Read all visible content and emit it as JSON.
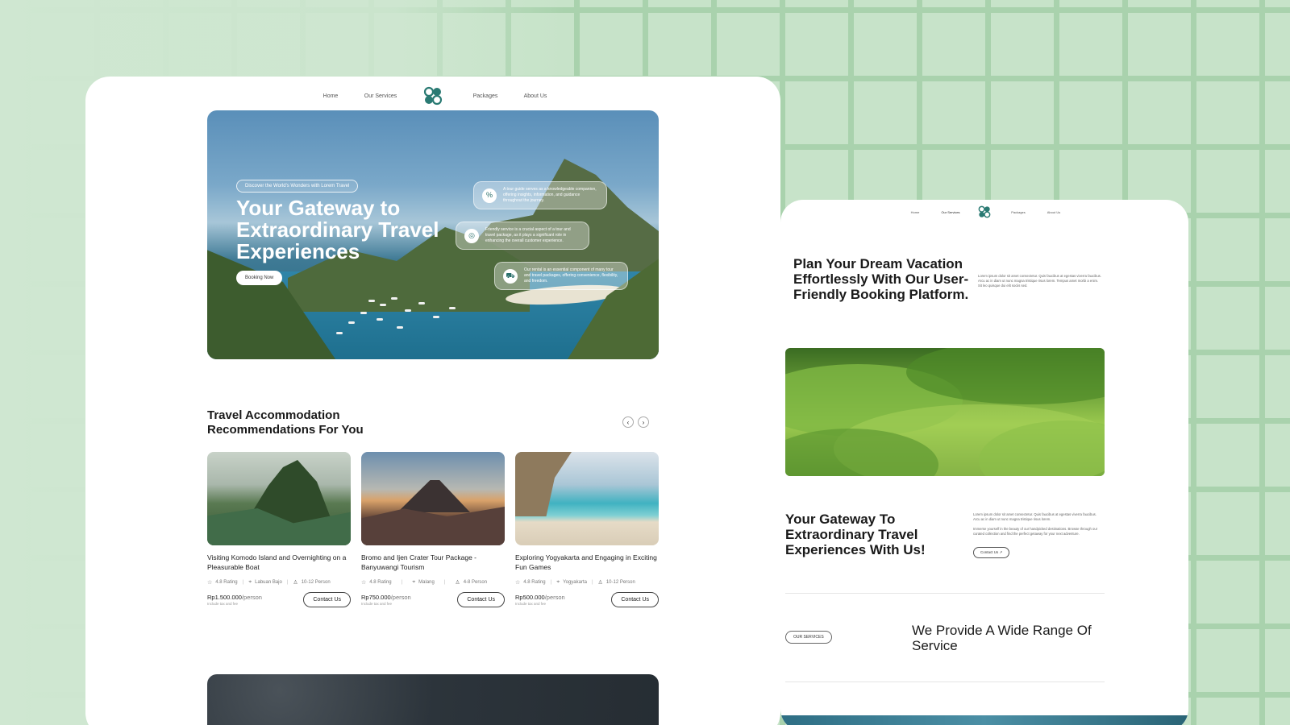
{
  "main": {
    "nav": {
      "home": "Home",
      "services": "Our Services",
      "packages": "Packages",
      "about": "About Us"
    },
    "hero": {
      "pill": "Discover the World's Wonders with Lorem Travel",
      "title": "Your Gateway to Extraordinary Travel Experiences",
      "cta": "Booking Now",
      "features": [
        {
          "icon": "percent-icon",
          "text": "A tour guide serves as a knowledgeable companion, offering insights, information, and guidance throughout the journey."
        },
        {
          "icon": "target-icon",
          "text": "Friendly service is a crucial aspect of a tour and travel package, as it plays a significant role in enhancing the overall customer experience."
        },
        {
          "icon": "car-icon",
          "text": "Our rental is an essential component of many tour and travel packages, offering convenience, flexibility, and freedom."
        }
      ]
    },
    "section_title": "Travel Accommodation Recommendations For You",
    "prev": "‹",
    "next": "›",
    "cards": [
      {
        "title": "Visiting Komodo Island and Overnighting on a Pleasurable Boat",
        "rating": "4.8 Rating",
        "location": "Labuan Bajo",
        "people": "10-12 Person",
        "price": "Rp1.500.000",
        "unit": "/person",
        "note": "Include tax and fee",
        "cta": "Contact Us"
      },
      {
        "title": "Bromo and Ijen Crater Tour Package - Banyuwangi Tourism",
        "rating": "4.8 Rating",
        "location": "Malang",
        "people": "4-8 Person",
        "price": "Rp750.000",
        "unit": "/person",
        "note": "Include tax and fee",
        "cta": "Contact Us"
      },
      {
        "title": "Exploring Yogyakarta and Engaging in Exciting Fun Games",
        "rating": "4.8 Rating",
        "location": "Yogyakarta",
        "people": "10-12 Person",
        "price": "Rp500.000",
        "unit": "/person",
        "note": "Include tax and fee",
        "cta": "Contact Us"
      }
    ]
  },
  "second": {
    "nav": {
      "home": "Home",
      "services": "Our Services",
      "packages": "Packages",
      "about": "About Us"
    },
    "title": "Plan Your Dream Vacation Effortlessly With Our User-Friendly Booking Platform.",
    "lorem": "Lorem ipsum dolor sit amet consectetur. Quis faucibus at egestas viverra faucibus. Arcu ac in diam ut nunc magna tristique risus lorem. Tempus amet morbi a enim. Sit leo quisque dui elit sociis sed.",
    "gateway_title": "Your Gateway To Extraordinary Travel Experiences With Us!",
    "gateway_p1": "Lorem ipsum dolor sit amet consectetur. Quis faucibus at egestas viverra faucibus. Arcu ac in diam ut nunc magna tristique risus lorem.",
    "gateway_p2": "Immerse yourself in the beauty of our handpicked destinations. Browse through our curated collection and find the perfect getaway for your next adventure.",
    "contact": "Contact Us ↗",
    "badge": "OUR SERVICES",
    "services_title": "We Provide A Wide Range Of Service"
  },
  "colors": {
    "background": "#c7e3c9",
    "grid_line": "#a9d2ad",
    "logo": "#2a7a73",
    "text_dark": "#1a1a1a"
  }
}
